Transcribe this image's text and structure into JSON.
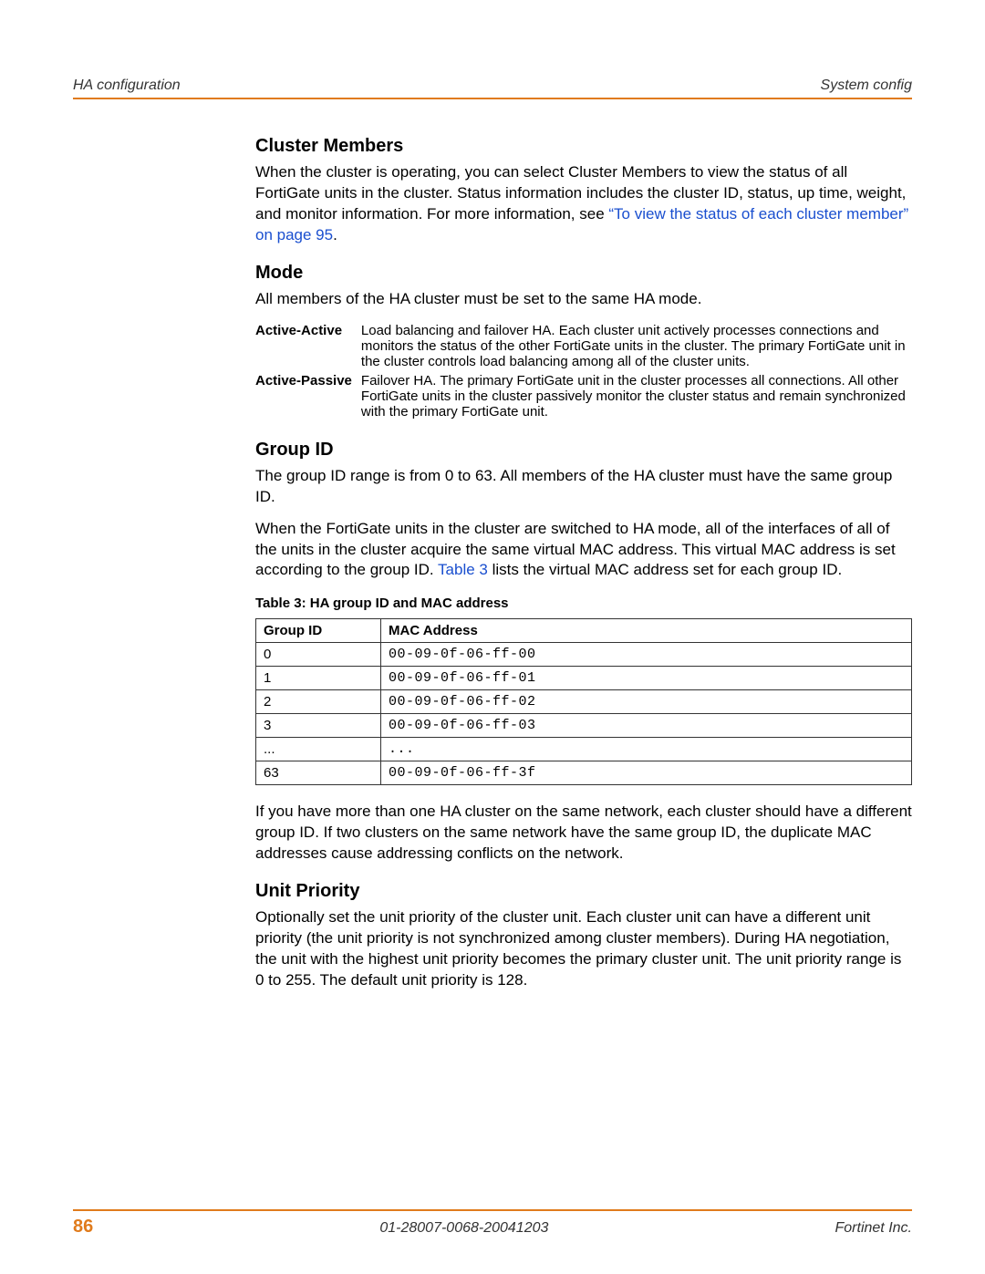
{
  "header": {
    "left": "HA configuration",
    "right": "System config"
  },
  "sections": {
    "cluster_members": {
      "title": "Cluster Members",
      "para1_a": "When the cluster is operating, you can select Cluster Members to view the status of all FortiGate units in the cluster. Status information includes the cluster ID, status, up time, weight, and monitor information. For more information, see ",
      "para1_link": "“To view the status of each cluster member” on page 95",
      "para1_b": "."
    },
    "mode": {
      "title": "Mode",
      "intro": "All members of the HA cluster must be set to the same HA mode.",
      "items": [
        {
          "term": "Active-Active",
          "desc": "Load balancing and failover HA. Each cluster unit actively processes connections and monitors the status of the other FortiGate units in the cluster. The primary FortiGate unit in the cluster controls load balancing among all of the cluster units."
        },
        {
          "term": "Active-Passive",
          "desc": "Failover HA. The primary FortiGate unit in the cluster processes all connections. All other FortiGate units in the cluster passively monitor the cluster status and remain synchronized with the primary FortiGate unit."
        }
      ]
    },
    "group_id": {
      "title": "Group ID",
      "para1": "The group ID range is from 0 to 63. All members of the HA cluster must have the same group ID.",
      "para2_a": "When the FortiGate units in the cluster are switched to HA mode, all of the interfaces of all of the units in the cluster acquire the same virtual MAC address. This virtual MAC address is set according to the group ID. ",
      "para2_link": "Table 3",
      "para2_b": " lists the virtual MAC address set for each group ID.",
      "table_caption": "Table 3: HA group ID and MAC address",
      "table_headers": {
        "id": "Group ID",
        "mac": "MAC Address"
      },
      "table_rows": [
        {
          "id": "0",
          "mac": "00-09-0f-06-ff-00"
        },
        {
          "id": "1",
          "mac": "00-09-0f-06-ff-01"
        },
        {
          "id": "2",
          "mac": "00-09-0f-06-ff-02"
        },
        {
          "id": "3",
          "mac": "00-09-0f-06-ff-03"
        },
        {
          "id": "...",
          "mac": "..."
        },
        {
          "id": "63",
          "mac": "00-09-0f-06-ff-3f"
        }
      ],
      "para3": "If you have more than one HA cluster on the same network, each cluster should have a different group ID. If two clusters on the same network have the same group ID, the duplicate MAC addresses cause addressing conflicts on the network."
    },
    "unit_priority": {
      "title": "Unit Priority",
      "para": "Optionally set the unit priority of the cluster unit. Each cluster unit can have a different unit priority (the unit priority is not synchronized among cluster members). During HA negotiation, the unit with the highest unit priority becomes the primary cluster unit. The unit priority range is 0 to 255. The default unit priority is 128."
    }
  },
  "footer": {
    "page": "86",
    "center": "01-28007-0068-20041203",
    "right": "Fortinet Inc."
  }
}
